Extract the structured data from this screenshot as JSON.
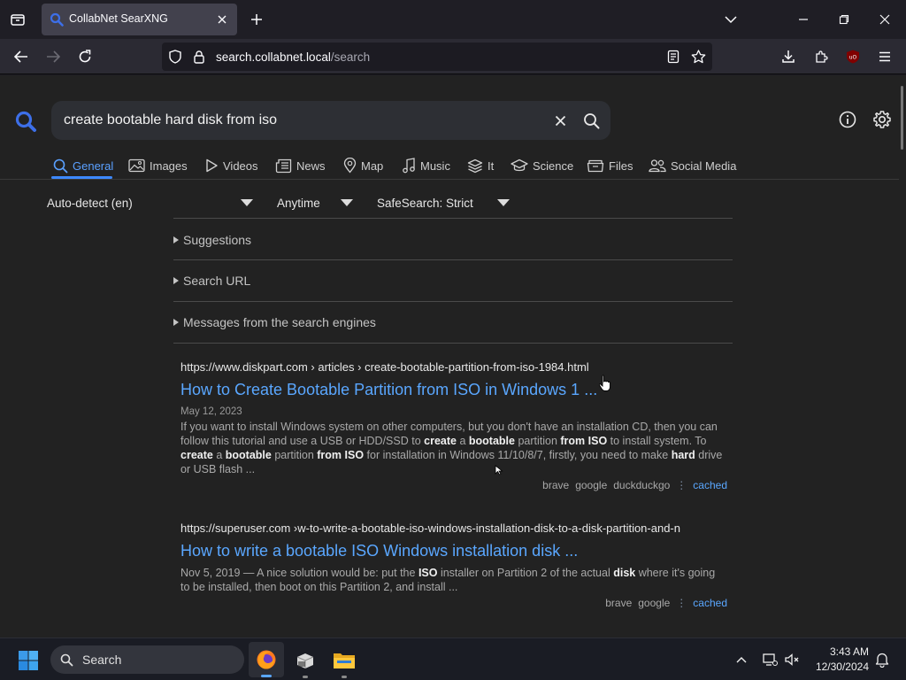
{
  "browser": {
    "tab_title": "CollabNet SearXNG",
    "url_host": "search.collabnet.local",
    "url_path": "/search"
  },
  "search": {
    "query": "create bootable hard disk from iso"
  },
  "categories": [
    {
      "label": "General",
      "icon": "search-icon",
      "active": true
    },
    {
      "label": "Images",
      "icon": "image-icon"
    },
    {
      "label": "Videos",
      "icon": "play-icon"
    },
    {
      "label": "News",
      "icon": "newspaper-icon"
    },
    {
      "label": "Map",
      "icon": "map-pin-icon"
    },
    {
      "label": "Music",
      "icon": "music-note-icon"
    },
    {
      "label": "It",
      "icon": "layers-icon"
    },
    {
      "label": "Science",
      "icon": "graduation-cap-icon"
    },
    {
      "label": "Files",
      "icon": "files-icon"
    },
    {
      "label": "Social Media",
      "icon": "people-icon"
    }
  ],
  "filters": {
    "language": "Auto-detect (en)",
    "time": "Anytime",
    "safesearch": "SafeSearch: Strict"
  },
  "sections": {
    "suggestions": "Suggestions",
    "search_url": "Search URL",
    "messages": "Messages from the search engines"
  },
  "results": [
    {
      "url_host": "https://www.diskpart.com",
      "url_path": " › articles › create-bootable-partition-from-iso-1984.html",
      "title": "How to Create Bootable Partition from ISO in Windows 1 ...",
      "date": "May 12, 2023",
      "engines": [
        "brave",
        "google",
        "duckduckgo"
      ],
      "cached": "cached"
    },
    {
      "url_host": "https://superuser.com",
      "url_path": " ›w-to-write-a-bootable-iso-windows-installation-disk-to-a-disk-partition-and-n",
      "title": "How to write a bootable ISO Windows installation disk ...",
      "engines": [
        "brave",
        "google"
      ],
      "cached": "cached"
    }
  ],
  "taskbar": {
    "search_label": "Search",
    "time": "3:43 AM",
    "date": "12/30/2024"
  }
}
